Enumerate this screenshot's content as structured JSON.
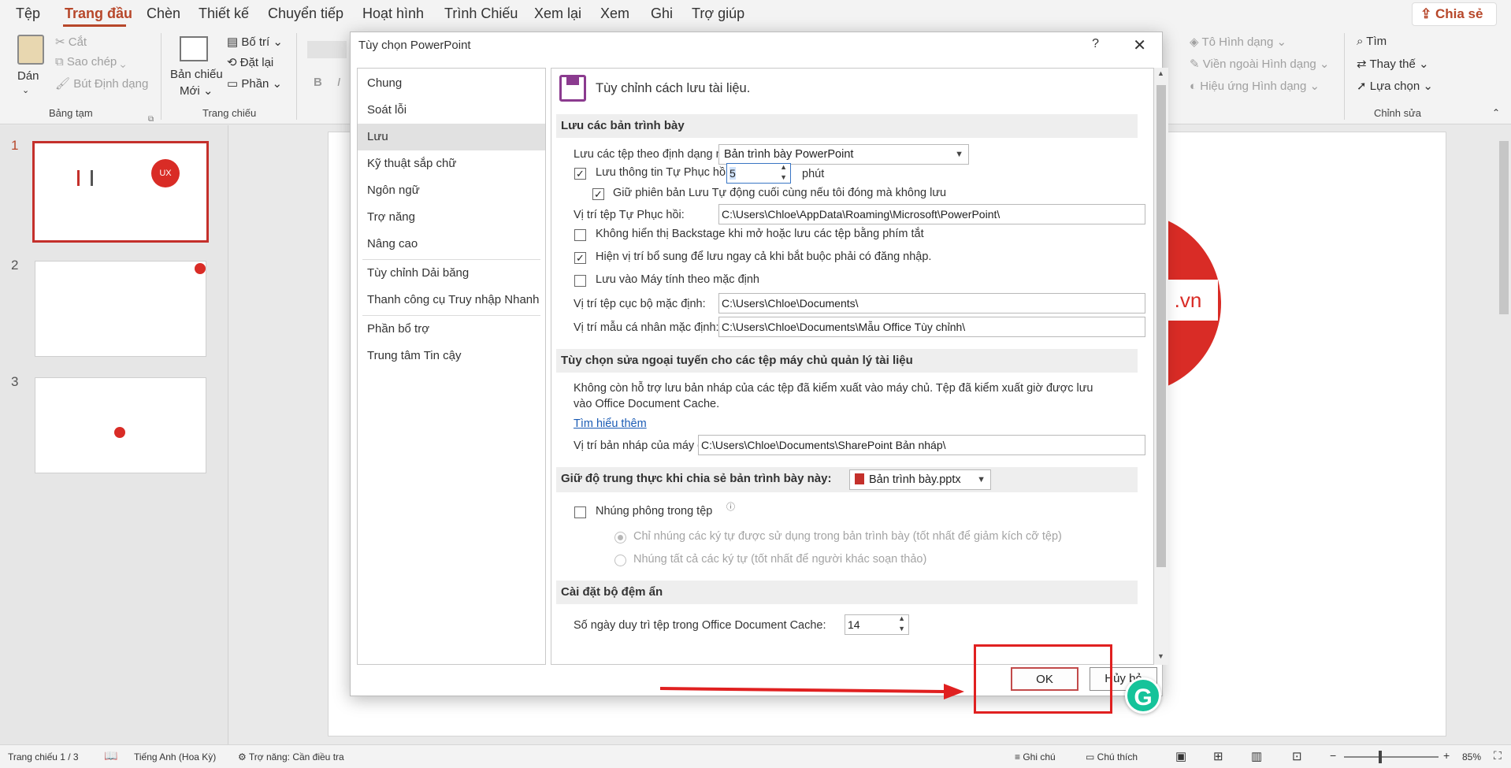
{
  "menu": {
    "tabs": [
      "Tệp",
      "Trang đầu",
      "Chèn",
      "Thiết kế",
      "Chuyển tiếp",
      "Hoạt hình",
      "Trình Chiếu",
      "Xem lại",
      "Xem",
      "Ghi",
      "Trợ giúp"
    ],
    "share": "Chia sẻ"
  },
  "ribbon": {
    "paste": "Dán",
    "cut": "Cắt",
    "copy": "Sao chép",
    "format_painter": "Bút Định dạng",
    "clipboard_group": "Bảng tạm",
    "new_slide_1": "Bản chiếu",
    "new_slide_2": "Mới",
    "layout": "Bố trí",
    "reset": "Đặt lại",
    "section": "Phần",
    "slides_group": "Trang chiếu",
    "shape_fill": "Tô Hình dạng",
    "shape_outline": "Viền ngoài Hình dạng",
    "shape_effects": "Hiệu ứng Hình dạng",
    "find": "Tìm",
    "replace": "Thay thế",
    "select": "Lựa chọn",
    "editing_group": "Chỉnh sửa",
    "bold": "B",
    "italic": "I"
  },
  "slides": {
    "numbers": [
      "1",
      "2",
      "3"
    ],
    "logo_small": "UX"
  },
  "canvas": {
    "domain_suffix": ".vn"
  },
  "status": {
    "slide_count": "Trang chiếu 1 / 3",
    "language": "Tiếng Anh (Hoa Kỳ)",
    "accessibility": "Trợ năng: Cần điều tra",
    "notes": "Ghi chú",
    "comments": "Chú thích",
    "zoom": "85%"
  },
  "dialog": {
    "title": "Tùy chọn PowerPoint",
    "help": "?",
    "close": "✕",
    "nav": [
      "Chung",
      "Soát lỗi",
      "Lưu",
      "Kỹ thuật sắp chữ",
      "Ngôn ngữ",
      "Trợ năng",
      "Nâng cao",
      "Tùy chỉnh Dải băng",
      "Thanh công cụ Truy nhập Nhanh",
      "Phần bổ trợ",
      "Trung tâm Tin cậy"
    ],
    "header": "Tùy chỉnh cách lưu tài liệu.",
    "sec_save": "Lưu các bản trình bày",
    "save_format_label": "Lưu các tệp theo định dạng này:",
    "save_format_value": "Bản trình bày PowerPoint",
    "autorecover_label": "Lưu thông tin Tự Phục hồi mỗi",
    "autorecover_minutes": "5",
    "minutes_unit": "phút",
    "keep_last": "Giữ phiên bản Lưu Tự động cuối cùng nếu tôi đóng mà không lưu",
    "autorecover_loc_label": "Vị trí tệp Tự Phục hồi:",
    "autorecover_loc_value": "C:\\Users\\Chloe\\AppData\\Roaming\\Microsoft\\PowerPoint\\",
    "no_backstage": "Không hiển thị Backstage khi mở hoặc lưu các tệp bằng phím tắt",
    "show_extra": "Hiện vị trí bổ sung để lưu ngay cả khi bắt buộc phải có đăng nhập.",
    "save_to_computer": "Lưu vào Máy tính theo mặc định",
    "local_loc_label": "Vị trí tệp cục bộ mặc định:",
    "local_loc_value": "C:\\Users\\Chloe\\Documents\\",
    "template_loc_label": "Vị trí mẫu cá nhân mặc định:",
    "template_loc_value": "C:\\Users\\Chloe\\Documents\\Mẫu Office Tùy chỉnh\\",
    "sec_offline": "Tùy chọn sửa ngoại tuyến cho các tệp máy chủ quản lý tài liệu",
    "offline_text_1": "Không còn hỗ trợ lưu bản nháp của các tệp đã kiểm xuất vào máy chủ. Tệp đã kiểm xuất giờ được lưu",
    "offline_text_2": "vào Office Document Cache.",
    "learn_more": "Tìm hiểu thêm",
    "drafts_label": "Vị trí bản nháp của máy chủ:",
    "drafts_value": "C:\\Users\\Chloe\\Documents\\SharePoint Bản nháp\\",
    "sec_fidelity": "Giữ độ trung thực khi chia sẻ bản trình bày này:",
    "fidelity_file": "Bản trình bày.pptx",
    "embed_fonts": "Nhúng phông trong tệp",
    "embed_used": "Chỉ nhúng các ký tự được sử dụng trong bản trình bày (tốt nhất để giảm kích cỡ tệp)",
    "embed_all": "Nhúng tất cả các ký tự (tốt nhất để người khác soạn thảo)",
    "sec_cache": "Cài đặt bộ đệm ẩn",
    "cache_days_label": "Số ngày duy trì tệp trong Office Document Cache:",
    "cache_days_value": "14",
    "ok": "OK",
    "cancel": "Hủy bỏ"
  },
  "colors": {
    "accent": "#b7472a",
    "highlight": "#e02020",
    "logo": "#d92c26"
  }
}
